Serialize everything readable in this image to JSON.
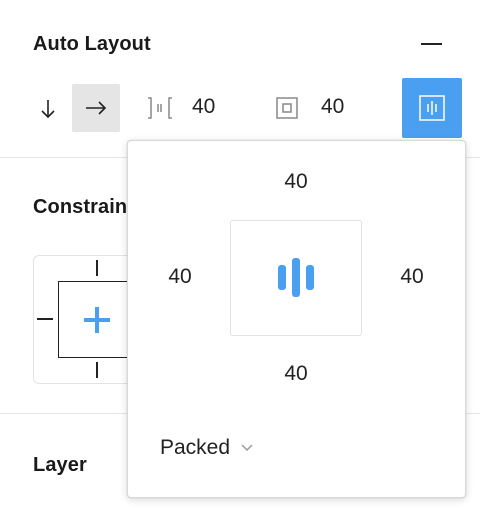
{
  "auto_layout": {
    "title": "Auto Layout",
    "spacing_value": "40",
    "padding_value": "40"
  },
  "constraints": {
    "title": "Constrain"
  },
  "layer": {
    "title": "Layer"
  },
  "popover": {
    "padding_top": "40",
    "padding_left": "40",
    "padding_right": "40",
    "padding_bottom": "40",
    "distribution": "Packed"
  },
  "colors": {
    "accent": "#4a9ff0",
    "selected_bg": "#e5e5e5",
    "text": "#1a1a1a",
    "icon_gray": "#777777"
  },
  "icons": {
    "vertical_direction": "arrow-down-icon",
    "horizontal_direction": "arrow-right-icon",
    "spacing": "spacing-between-icon",
    "padding": "padding-icon",
    "alignment": "alignment-settings-icon",
    "constraint_center": "plus-icon",
    "distribution_chevron": "chevron-down-icon"
  }
}
